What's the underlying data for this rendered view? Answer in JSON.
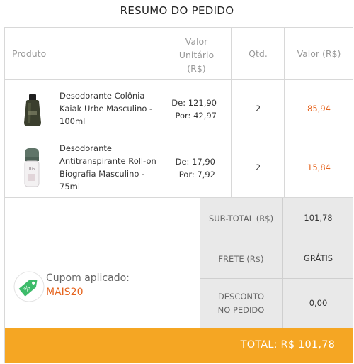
{
  "title": "RESUMO DO PEDIDO",
  "table": {
    "headers": {
      "produto": "Produto",
      "valor_unitario_1": "Valor",
      "valor_unitario_2": "Unitário",
      "valor_unitario_3": "(R$)",
      "qtd": "Qtd.",
      "valor": "Valor (R$)"
    },
    "rows": [
      {
        "name_1": "Desodorante Colônia",
        "name_2": "Kaiak Urbe Masculino -",
        "name_3": "100ml",
        "de": "De: 121,90",
        "por": "Por: 42,97",
        "qty": "2",
        "total": "85,94"
      },
      {
        "name_1": "Desodorante",
        "name_2": "Antitranspirante Roll-on",
        "name_3": "Biografia Masculino -",
        "name_4": "75ml",
        "de": "De: 17,90",
        "por": "Por: 7,92",
        "qty": "2",
        "total": "15,84"
      }
    ]
  },
  "summary": {
    "subtotal_label": "SUB-TOTAL (R$)",
    "subtotal_value": "101,78",
    "frete_label": "FRETE (R$)",
    "frete_value": "GRÁTIS",
    "desconto_label_1": "DESCONTO",
    "desconto_label_2": "NO PEDIDO",
    "desconto_value": "0,00"
  },
  "coupon": {
    "label": "Cupom aplicado:",
    "code": "MAIS20",
    "icon": "coupon-tag-icon",
    "icon_text": "%"
  },
  "total": "TOTAL: R$ 101,78",
  "colors": {
    "accent": "#e6641e",
    "total_bar": "#f5a623",
    "coupon_green": "#3dbb6a"
  }
}
